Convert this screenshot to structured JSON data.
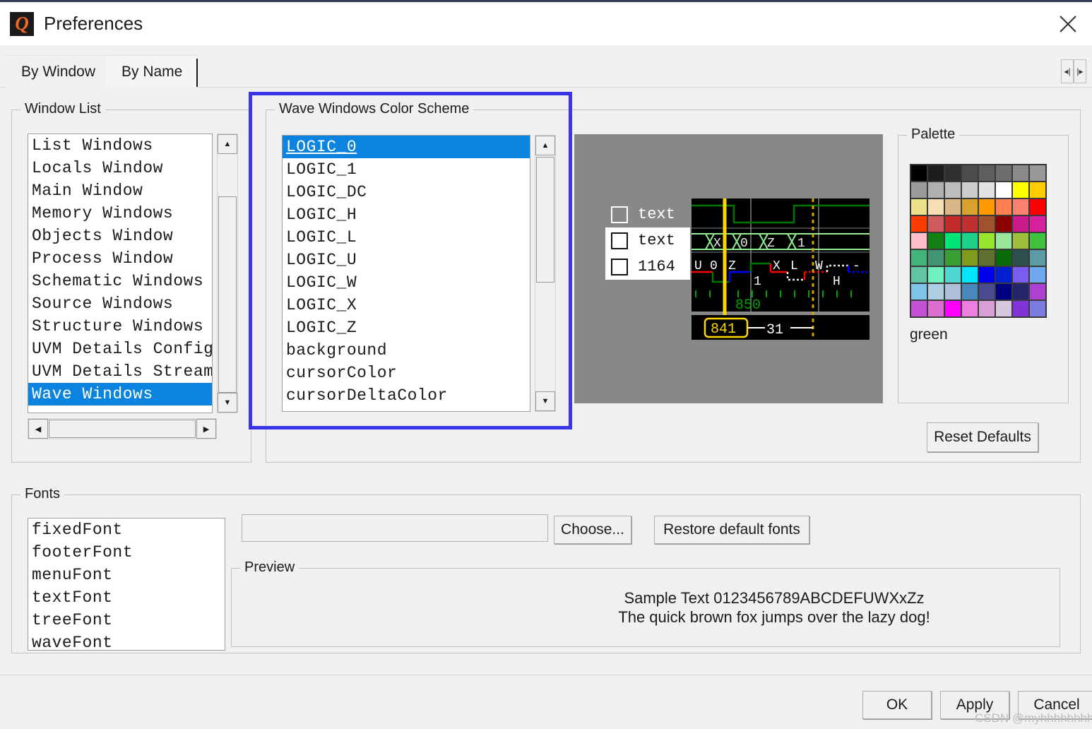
{
  "window": {
    "title": "Preferences",
    "icon": "questa-logo-icon",
    "close_icon": "close-icon"
  },
  "tabs": [
    {
      "label": "By Window",
      "active": true
    },
    {
      "label": "By Name",
      "active": false
    }
  ],
  "tab_scroll": {
    "left_icon": "◀|",
    "right_icon": "|▶"
  },
  "window_list": {
    "legend": "Window List",
    "items": [
      {
        "label": "List Windows",
        "selected": false
      },
      {
        "label": "Locals Window",
        "selected": false
      },
      {
        "label": "Main Window",
        "selected": false
      },
      {
        "label": "Memory Windows",
        "selected": false
      },
      {
        "label": "Objects Window",
        "selected": false
      },
      {
        "label": "Process Window",
        "selected": false
      },
      {
        "label": "Schematic Windows",
        "selected": false
      },
      {
        "label": "Source Windows",
        "selected": false
      },
      {
        "label": "Structure Windows",
        "selected": false
      },
      {
        "label": "UVM Details ConfigD",
        "selected": false
      },
      {
        "label": "UVM Details Stream",
        "selected": false
      },
      {
        "label": "Wave Windows",
        "selected": true
      }
    ],
    "vscroll": {
      "up": "▲",
      "down": "▼"
    },
    "hscroll": {
      "left": "◀",
      "right": "▶"
    }
  },
  "color_scheme": {
    "legend": "Wave Windows Color Scheme",
    "items": [
      {
        "label": "LOGIC_0",
        "selected": true
      },
      {
        "label": "LOGIC_1",
        "selected": false
      },
      {
        "label": "LOGIC_DC",
        "selected": false
      },
      {
        "label": "LOGIC_H",
        "selected": false
      },
      {
        "label": "LOGIC_L",
        "selected": false
      },
      {
        "label": "LOGIC_U",
        "selected": false
      },
      {
        "label": "LOGIC_W",
        "selected": false
      },
      {
        "label": "LOGIC_X",
        "selected": false
      },
      {
        "label": "LOGIC_Z",
        "selected": false
      },
      {
        "label": "background",
        "selected": false
      },
      {
        "label": "cursorColor",
        "selected": false
      },
      {
        "label": "cursorDeltaColor",
        "selected": false
      }
    ],
    "vscroll": {
      "up": "▲",
      "down": "▼"
    }
  },
  "wave_preview": {
    "rows": [
      {
        "label": "text",
        "style": "dark"
      },
      {
        "label": "text",
        "style": "light"
      },
      {
        "label": "1164",
        "style": "light"
      }
    ],
    "bus_values": [
      "X",
      "0",
      "Z",
      "1"
    ],
    "logic_values": [
      "U",
      "0",
      "Z",
      "X",
      "L",
      "W",
      "-"
    ],
    "extra_values": [
      "1",
      "H"
    ],
    "time_label": "850",
    "cursor_label": "841",
    "delta_label": "31",
    "colors": {
      "background": "#000000",
      "panel": "#888888",
      "logic_0": "#008000",
      "logic_1": "#008000",
      "bus": "#90ee90",
      "cursor": "#ffd700",
      "cursor_delta": "#d8a000",
      "logic_x": "#ff0000",
      "logic_z": "#0000ff",
      "text": "#ffffff",
      "grid": "#808080"
    }
  },
  "palette": {
    "legend": "Palette",
    "selected_name": "green",
    "colors": [
      [
        "#000000",
        "#1d1d1d",
        "#303030",
        "#4c4c4c",
        "#5e5e5e",
        "#6e6e6e",
        "#8a8a8a",
        "#989898"
      ],
      [
        "#9b9b9b",
        "#b0b0b0",
        "#bdbdbd",
        "#cccccc",
        "#e2e2e2",
        "#ffffff",
        "#ffff00",
        "#ffcc00"
      ],
      [
        "#ece28c",
        "#f6dfb4",
        "#d9b787",
        "#d9a22e",
        "#ff9900",
        "#ff7f50",
        "#fa8072",
        "#ff0000"
      ],
      [
        "#fa3c00",
        "#cd5c5c",
        "#c42a2a",
        "#bf3030",
        "#a0522d",
        "#8b0000",
        "#cc1a8c",
        "#d6219e"
      ],
      [
        "#ffc0cb",
        "#128012",
        "#00e676",
        "#1fd18a",
        "#9ae62e",
        "#98e69a",
        "#9dbf3b",
        "#41c23f"
      ],
      [
        "#43b57b",
        "#3f9670",
        "#3a9e34",
        "#7f9b1e",
        "#61702f",
        "#0a6b0a",
        "#2e4f4f",
        "#5b9ba3"
      ],
      [
        "#63c4a5",
        "#6ef0c0",
        "#4fd6d0",
        "#00e5ff",
        "#0000ee",
        "#0020d0",
        "#7a5cf0",
        "#6fa8ee"
      ],
      [
        "#7fc4e8",
        "#adcde2",
        "#aec0d8",
        "#4a87bd",
        "#4a4a8e",
        "#000080",
        "#25256b",
        "#ad3fd1"
      ],
      [
        "#c452d6",
        "#dd6ed1",
        "#ff00ff",
        "#ec7fe0",
        "#d79fd5",
        "#d9c6df",
        "#8033d6",
        "#7a7ae0"
      ]
    ]
  },
  "reset_defaults_label": "Reset Defaults",
  "fonts": {
    "legend": "Fonts",
    "items": [
      {
        "label": "fixedFont"
      },
      {
        "label": "footerFont"
      },
      {
        "label": "menuFont"
      },
      {
        "label": "textFont"
      },
      {
        "label": "treeFont"
      },
      {
        "label": "waveFont"
      }
    ],
    "font_field_value": "",
    "choose_label": "Choose...",
    "restore_label": "Restore default fonts"
  },
  "preview": {
    "legend": "Preview",
    "line1": "Sample Text 0123456789ABCDEFUWXxZz",
    "line2": "The quick brown fox jumps over the lazy dog!"
  },
  "buttons": {
    "ok": "OK",
    "apply": "Apply",
    "cancel": "Cancel"
  },
  "watermark": "CSDN @myhhhhhhhh"
}
